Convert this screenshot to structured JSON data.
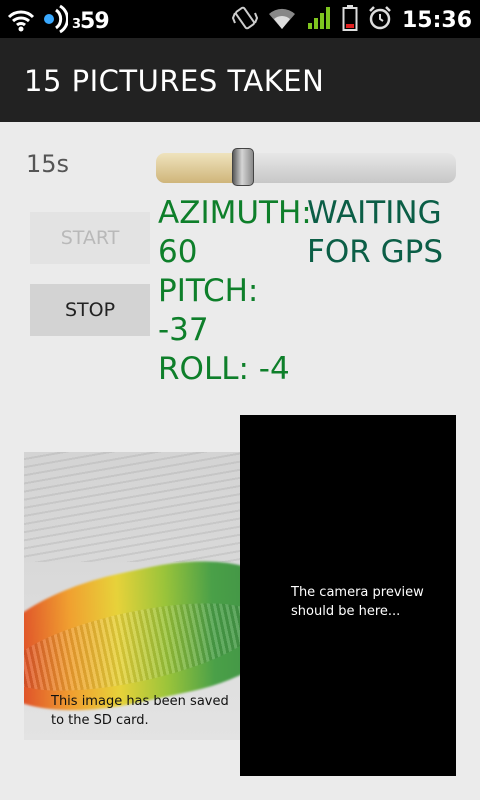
{
  "status_bar": {
    "notification_count": "59",
    "notification_prefix": "3",
    "time": "15:36",
    "icons": [
      "wifi-icon",
      "sync-icon",
      "vibrate-icon",
      "wifi-icon",
      "signal-icon",
      "battery-icon",
      "alarm-icon"
    ]
  },
  "title_bar": {
    "title": "15 PICTURES TAKEN"
  },
  "controls": {
    "interval_label": "15s",
    "slider_value_fraction": 0.29,
    "start_label": "START",
    "stop_label": "STOP"
  },
  "sensors": {
    "azimuth": "AZIMUTH: 60",
    "pitch": "PITCH: -37",
    "roll": "ROLL: -4",
    "gps_status": "WAITING FOR GPS"
  },
  "photo": {
    "caption": "This image has been saved to the SD card."
  },
  "preview": {
    "caption": "The camera preview should be here..."
  },
  "colors": {
    "sensor_text": "#0e7f2a",
    "gps_text": "#0b5e46",
    "title_bar_bg": "#222222",
    "slider_fill": "#cfb57a"
  }
}
